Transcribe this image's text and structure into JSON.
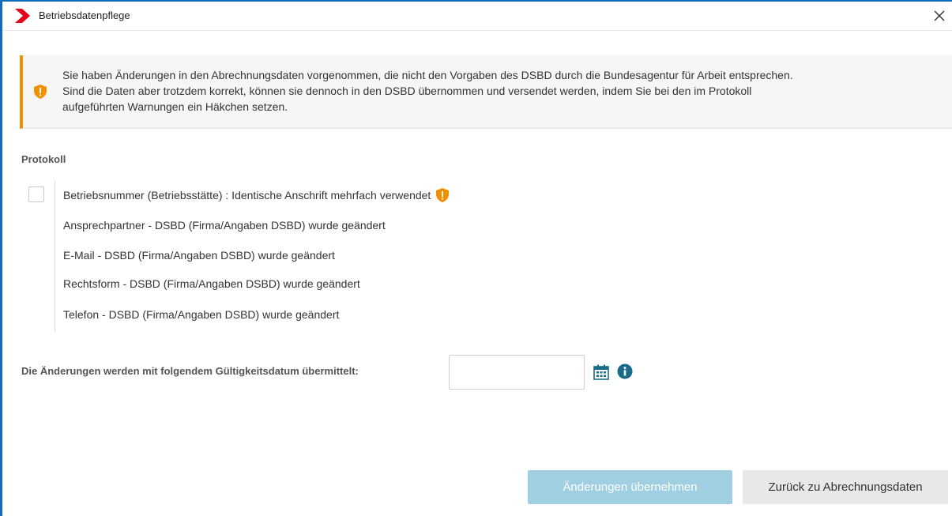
{
  "window": {
    "title": "Betriebsdatenpflege",
    "accent_color": "#0f6cbd"
  },
  "banner": {
    "icon": "shield-warning-icon",
    "color": "#f29100",
    "text": "Sie haben Änderungen in den Abrechnungsdaten vorgenommen, die nicht den Vorgaben des DSBD durch die Bundesagentur für Arbeit entsprechen.\nSind die Daten aber trotzdem korrekt, können sie dennoch in den DSBD übernommen und versendet werden, indem Sie bei den im Protokoll\naufgeführten Warnungen ein Häkchen setzen."
  },
  "protocol": {
    "title": "Protokoll",
    "items": [
      {
        "text": "Betriebsnummer (Betriebsstätte) : Identische Anschrift mehrfach verwendet",
        "warning": true,
        "checked": false
      },
      {
        "text": "Ansprechpartner - DSBD (Firma/Angaben DSBD) wurde geändert",
        "warning": false
      },
      {
        "text": "E-Mail - DSBD (Firma/Angaben DSBD) wurde geändert",
        "warning": false
      },
      {
        "text": "Rechtsform - DSBD (Firma/Angaben DSBD) wurde geändert",
        "warning": false
      },
      {
        "text": "Telefon - DSBD (Firma/Angaben DSBD) wurde geändert",
        "warning": false
      }
    ]
  },
  "date": {
    "label": "Die Änderungen werden mit folgendem Gültigkeitsdatum übermittelt:",
    "value": "",
    "icon_color": "#1a6a8a"
  },
  "buttons": {
    "apply": "Änderungen übernehmen",
    "back": "Zurück zu Abrechnungsdaten"
  }
}
